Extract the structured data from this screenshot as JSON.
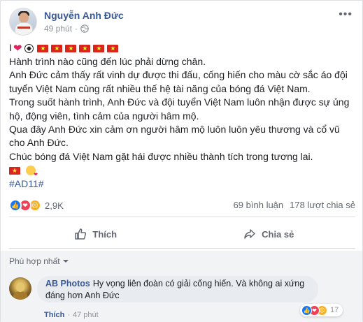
{
  "post": {
    "author": "Nguyễn Anh Đức",
    "time": "49 phút",
    "privacy_icon": "globe-icon",
    "first_line_prefix": "I",
    "text_lines": [
      "Hành trình nào cũng đến lúc phải dừng chân.",
      "Anh Đức cảm thấy rất vinh dự được thi đấu, cống hiến cho màu cờ sắc áo đội tuyển Việt Nam cùng rất nhiều thế hệ tài năng của bóng đá Việt Nam.",
      "Trong suốt hành trình, Anh Đức và đội tuyển Việt Nam luôn nhận được sự ủng hộ, động viên, tình cảm của người hâm mộ.",
      "Qua đây Anh Đức xin cảm ơn người hâm mộ luôn luôn yêu thương và cổ vũ cho Anh Đức.",
      "Chúc bóng đá Việt Nam gặt hái được nhiều thành tích trong tương lai."
    ],
    "hashtag": "#AD11#"
  },
  "stats": {
    "reaction_count": "2,9K",
    "comments": "69 bình luận",
    "shares": "178 lượt chia sẻ"
  },
  "actions": {
    "like": "Thích",
    "share": "Chia sẻ"
  },
  "comments": {
    "sort_label": "Phù hợp nhất",
    "items": [
      {
        "author": "AB Photos",
        "text": "Hy vọng liên đoàn có giải cống hiến. Và không ai xứng đáng hơn Anh Đức",
        "reaction_count": "17",
        "like_label": "Thích",
        "time": "47 phút"
      }
    ]
  },
  "colors": {
    "link": "#385898",
    "like_blue": "#1877f2",
    "love_red": "#f33e58",
    "sad_yellow": "#f7b125",
    "flag_red": "#da251d"
  }
}
